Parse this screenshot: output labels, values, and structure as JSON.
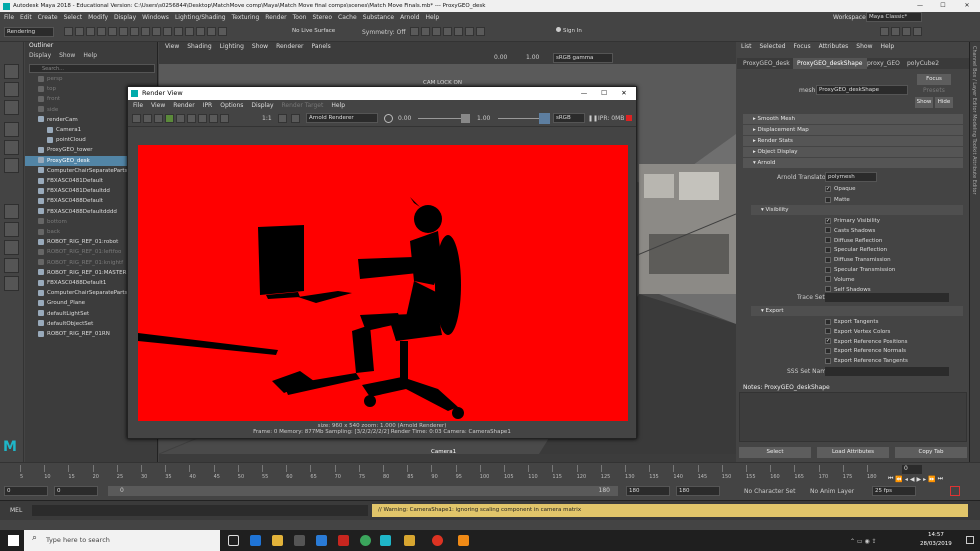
{
  "window": {
    "title": "Autodesk Maya 2018 - Educational Version: C:\\Users\\s0256844\\Desktop\\MatchMove comp\\Maya\\Match Move final comps\\scenes\\Match Move Finals.mb* --- ProxyGEO_desk",
    "min": "—",
    "max": "☐",
    "close": "✕"
  },
  "menubar": [
    "File",
    "Edit",
    "Create",
    "Select",
    "Modify",
    "Display",
    "Windows",
    "Lighting/Shading",
    "Texturing",
    "Render",
    "Toon",
    "Stereo",
    "Cache",
    "Substance",
    "Arnold",
    "Help"
  ],
  "workspace": {
    "label": "Workspace :",
    "value": "Maya Classic*"
  },
  "shelf": {
    "mode": "Rendering",
    "live_surface": "No Live Surface",
    "symmetry": "Symmetry: Off",
    "sign_in": "Sign In"
  },
  "outliner": {
    "title": "Outliner",
    "menu": [
      "Display",
      "Show",
      "Help"
    ],
    "search": "Search...",
    "items": [
      {
        "label": "persp",
        "dim": true,
        "indent": 1
      },
      {
        "label": "top",
        "dim": true,
        "indent": 1
      },
      {
        "label": "front",
        "dim": true,
        "indent": 1
      },
      {
        "label": "side",
        "dim": true,
        "indent": 1
      },
      {
        "label": "renderCam",
        "dim": false,
        "indent": 1
      },
      {
        "label": "Camera1",
        "dim": false,
        "indent": 2
      },
      {
        "label": "pointCloud",
        "dim": false,
        "indent": 2
      },
      {
        "label": "ProxyGEO_tower",
        "dim": false,
        "indent": 1
      },
      {
        "label": "ProxyGEO_desk",
        "dim": false,
        "indent": 1,
        "selected": true
      },
      {
        "label": "ComputerChairSeparateParts",
        "dim": false,
        "indent": 1
      },
      {
        "label": "FBXASC0481Default",
        "dim": false,
        "indent": 1
      },
      {
        "label": "FBXASC0481Defaultdd",
        "dim": false,
        "indent": 1
      },
      {
        "label": "FBXASC0488Default",
        "dim": false,
        "indent": 1
      },
      {
        "label": "FBXASC0488Defaultdddd",
        "dim": false,
        "indent": 1
      },
      {
        "label": "bottom",
        "dim": true,
        "indent": 1
      },
      {
        "label": "back",
        "dim": true,
        "indent": 1
      },
      {
        "label": "ROBOT_RIG_REF_01:robot",
        "dim": false,
        "indent": 1
      },
      {
        "label": "ROBOT_RIG_REF_01:leftfoo",
        "dim": true,
        "indent": 1
      },
      {
        "label": "ROBOT_RIG_REF_01:knightf",
        "dim": true,
        "indent": 1
      },
      {
        "label": "ROBOT_RIG_REF_01:MASTER",
        "dim": false,
        "indent": 1
      },
      {
        "label": "FBXASC0488Default1",
        "dim": false,
        "indent": 1
      },
      {
        "label": "ComputerChairSeparateParts",
        "dim": false,
        "indent": 1
      },
      {
        "label": "Ground_Plane",
        "dim": false,
        "indent": 1
      },
      {
        "label": "defaultLightSet",
        "dim": false,
        "indent": 1
      },
      {
        "label": "defaultObjectSet",
        "dim": false,
        "indent": 1
      },
      {
        "label": "ROBOT_RIG_REF_01RN",
        "dim": false,
        "indent": 1
      }
    ]
  },
  "viewport": {
    "menu": [
      "View",
      "Shading",
      "Lighting",
      "Show",
      "Renderer",
      "Panels"
    ],
    "exposure": "0.00",
    "gamma": "1.00",
    "colorspace": "sRGB gamma",
    "cam_label": "CAM LOCK ON",
    "camera_name": "Camera1"
  },
  "render_view": {
    "title": "Render View",
    "menu": [
      "File",
      "View",
      "Render",
      "IPR",
      "Options",
      "Display",
      "Render Target",
      "Help"
    ],
    "ratio": "1:1",
    "renderer": "Arnold Renderer",
    "exposure": "0.00",
    "gamma": "1.00",
    "colorspace": "sRGB gamma",
    "ipr": "IPR: 0MB",
    "status_line1": "size: 960 x 540  zoom: 1.000     (Arnold Renderer)",
    "status_line2": "Frame: 0     Memory: 877Mb     Sampling: [3/2/2/2/2/2]     Render Time: 0:03     Camera: CameraShape1"
  },
  "attribute_editor": {
    "menu": [
      "List",
      "Selected",
      "Focus",
      "Attributes",
      "Show",
      "Help"
    ],
    "tabs": [
      "ProxyGEO_desk",
      "ProxyGEO_deskShape",
      "proxy_GEO",
      "polyCube2"
    ],
    "mesh_label": "mesh:",
    "mesh_value": "ProxyGEO_deskShape",
    "focus": "Focus",
    "presets": "Presets",
    "show": "Show",
    "hide": "Hide",
    "sections": [
      "Smooth Mesh",
      "Displacement Map",
      "Render Stats",
      "Object Display",
      "Arnold"
    ],
    "translator_label": "Arnold Translator",
    "translator_value": "polymesh",
    "opaque": "Opaque",
    "matte": "Matte",
    "visibility_title": "Visibility",
    "visibility": [
      {
        "label": "Primary Visibility",
        "checked": true
      },
      {
        "label": "Casts Shadows",
        "checked": false
      },
      {
        "label": "Diffuse Reflection",
        "checked": false
      },
      {
        "label": "Specular Reflection",
        "checked": false
      },
      {
        "label": "Diffuse Transmission",
        "checked": false
      },
      {
        "label": "Specular Transmission",
        "checked": false
      },
      {
        "label": "Volume",
        "checked": false
      },
      {
        "label": "Self Shadows",
        "checked": false
      }
    ],
    "trace_sets": "Trace Sets",
    "export_title": "Export",
    "export": [
      {
        "label": "Export Tangents",
        "checked": false
      },
      {
        "label": "Export Vertex Colors",
        "checked": false
      },
      {
        "label": "Export Reference Positions",
        "checked": true
      },
      {
        "label": "Export Reference Normals",
        "checked": false
      },
      {
        "label": "Export Reference Tangents",
        "checked": false
      }
    ],
    "sss_label": "SSS Set Name",
    "notes": "Notes:  ProxyGEO_deskShape",
    "select_btn": "Select",
    "load_btn": "Load Attributes",
    "copy_btn": "Copy Tab",
    "side_tabs": "Channel Box / Layer Editor   Modeling Toolkit   Attribute Editor"
  },
  "timeline": {
    "ticks": [
      "5",
      "10",
      "15",
      "20",
      "25",
      "30",
      "35",
      "40",
      "45",
      "50",
      "55",
      "60",
      "65",
      "70",
      "75",
      "80",
      "85",
      "90",
      "95",
      "100",
      "105",
      "110",
      "115",
      "120",
      "125",
      "130",
      "135",
      "140",
      "145",
      "150",
      "155",
      "160",
      "165",
      "170",
      "175",
      "180"
    ],
    "current": "0"
  },
  "range": {
    "start": "0",
    "start2": "0",
    "slider_start": "0",
    "slider_end": "180",
    "end1": "180",
    "end2": "180",
    "character": "No Character Set",
    "anim_layer": "No Anim Layer",
    "fps": "25 fps"
  },
  "cmd": {
    "label": "MEL",
    "warning": "// Warning: CameraShape1: ignoring scaling component in camera matrix"
  },
  "taskbar": {
    "search": "Type here to search",
    "time": "14:57",
    "date": "28/03/2019"
  }
}
